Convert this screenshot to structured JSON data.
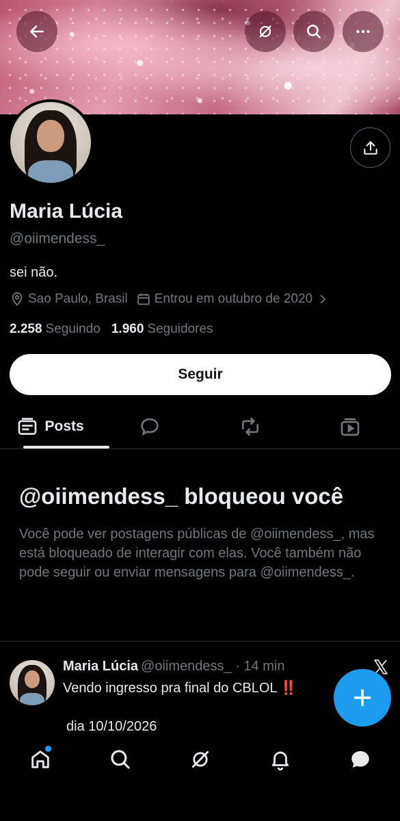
{
  "header": {
    "back_icon": "arrow-left-icon",
    "grok_icon": "grok-icon",
    "search_icon": "search-icon",
    "more_icon": "more-horizontal-icon"
  },
  "profile": {
    "name": "Maria Lúcia",
    "handle": "@oiimendess_",
    "bio": "sei não.",
    "location": "Sao Paulo, Brasil",
    "joined": "Entrou em outubro de 2020",
    "following_count": "2.258",
    "following_label": "Seguindo",
    "followers_count": "1.960",
    "followers_label": "Seguidores",
    "follow_button": "Seguir"
  },
  "tabs": [
    {
      "label": "Posts",
      "icon": "posts-icon",
      "active": true
    },
    {
      "label": "",
      "icon": "replies-icon"
    },
    {
      "label": "",
      "icon": "reposts-icon"
    },
    {
      "label": "",
      "icon": "media-icon"
    }
  ],
  "blocked": {
    "title": "@oiimendess_ bloqueou você",
    "message": "Você pode ver postagens públicas de @oiimendess_, mas está bloqueado de interagir com elas. Você também não pode seguir ou enviar mensagens para @oiimendess_."
  },
  "post": {
    "name": "Maria Lúcia",
    "handle": "@oiimendess_ · 14 min",
    "text": "Vendo ingresso pra final do CBLOL",
    "emoji": "‼️",
    "text_line2": "dia 10/10/2026"
  },
  "bottom_nav": [
    "home-icon",
    "search-icon",
    "grok-icon",
    "notifications-icon",
    "messages-icon"
  ],
  "colors": {
    "accent": "#1d9bf0",
    "background": "#000000",
    "text_primary": "#e7e9ea",
    "text_secondary": "#71767b"
  }
}
